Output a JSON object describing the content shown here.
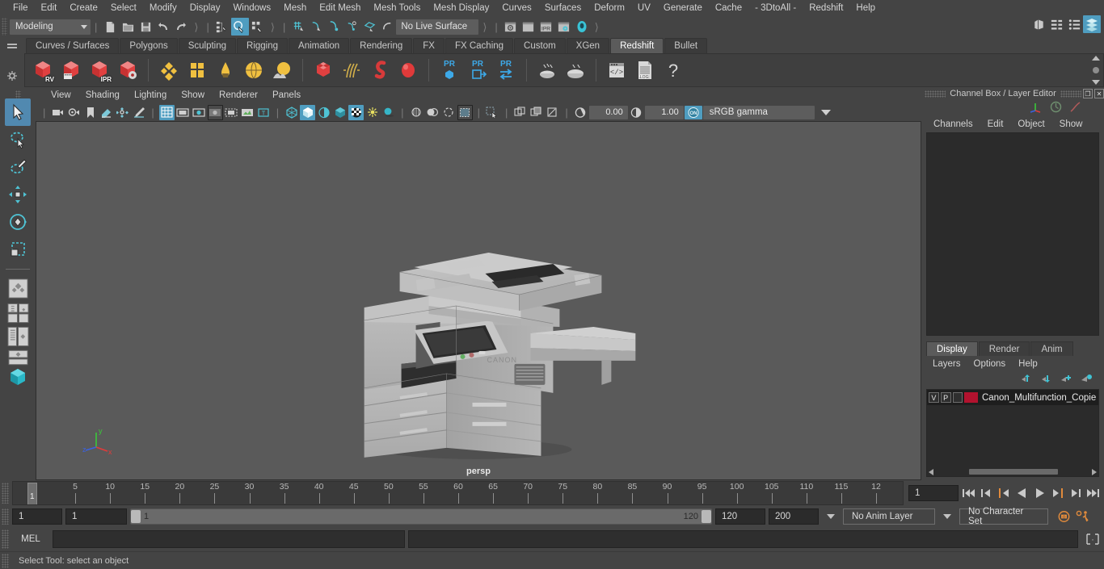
{
  "app": {
    "menus": [
      "File",
      "Edit",
      "Create",
      "Select",
      "Modify",
      "Display",
      "Windows",
      "Mesh",
      "Edit Mesh",
      "Mesh Tools",
      "Mesh Display",
      "Curves",
      "Surfaces",
      "Deform",
      "UV",
      "Generate",
      "Cache",
      "- 3DtoAll -",
      "Redshift",
      "Help"
    ]
  },
  "statusline": {
    "menuset": "Modeling",
    "live_surface": "No Live Surface",
    "icons": [
      "new-scene-icon",
      "open-scene-icon",
      "save-scene-icon",
      "undo-icon",
      "redo-icon",
      "select-by-hierarchy-icon",
      "select-by-object-icon",
      "select-by-component-icon",
      "snap-to-grid-icon",
      "snap-to-curve-icon",
      "snap-to-point-icon",
      "snap-to-projected-center-icon",
      "snap-to-view-plane-icon",
      "make-live-icon",
      "render-view-icon",
      "render-region-icon",
      "ipr-render-icon",
      "render-settings-icon",
      "hypershade-icon",
      "show-outliner-icon",
      "show-attribute-editor-icon",
      "show-tool-settings-icon",
      "show-channel-box-icon"
    ]
  },
  "shelf": {
    "tabs": [
      "Curves / Surfaces",
      "Polygons",
      "Sculpting",
      "Rigging",
      "Animation",
      "Rendering",
      "FX",
      "FX Caching",
      "Custom",
      "XGen",
      "Redshift",
      "Bullet"
    ],
    "active_tab": "Redshift",
    "icons": [
      {
        "name": "redshift-render-view-icon",
        "label": "RV"
      },
      {
        "name": "redshift-render-sequence-icon",
        "label": ""
      },
      {
        "name": "redshift-ipr-icon",
        "label": "IPR"
      },
      {
        "name": "redshift-render-settings-icon",
        "label": ""
      },
      {
        "name": "redshift-material-icon",
        "label": ""
      },
      {
        "name": "redshift-light-area-icon",
        "label": ""
      },
      {
        "name": "redshift-light-dome-icon",
        "label": ""
      },
      {
        "name": "redshift-light-ies-icon",
        "label": ""
      },
      {
        "name": "redshift-environment-icon",
        "label": ""
      },
      {
        "name": "redshift-proxy-icon",
        "label": ""
      },
      {
        "name": "redshift-hair-icon",
        "label": ""
      },
      {
        "name": "redshift-volume-icon",
        "label": ""
      },
      {
        "name": "redshift-sss-icon",
        "label": ""
      },
      {
        "name": "redshift-pr-object-icon",
        "label": "PR"
      },
      {
        "name": "redshift-pr-export-icon",
        "label": "PR"
      },
      {
        "name": "redshift-pr-transfer-icon",
        "label": "PR"
      },
      {
        "name": "redshift-bake-icon",
        "label": ""
      },
      {
        "name": "redshift-bake-set-icon",
        "label": ""
      },
      {
        "name": "redshift-script-icon",
        "label": ""
      },
      {
        "name": "redshift-log-icon",
        "label": ".LOG"
      },
      {
        "name": "redshift-help-icon",
        "label": "?"
      }
    ]
  },
  "toolbox": {
    "tools": [
      {
        "name": "select-tool",
        "active": true
      },
      {
        "name": "lasso-select-tool",
        "active": false
      },
      {
        "name": "paint-select-tool",
        "active": false
      },
      {
        "name": "move-tool",
        "active": false
      },
      {
        "name": "rotate-tool",
        "active": false
      },
      {
        "name": "scale-tool",
        "active": false
      },
      {
        "name": "last-tool-used",
        "active": false
      }
    ],
    "layouts": [
      "single-perspective-layout",
      "four-view-layout",
      "persp-outliner-layout",
      "persp-graph-layout",
      "hypershade-layout",
      "persp-bottom-layout"
    ]
  },
  "viewport": {
    "menus": [
      "View",
      "Shading",
      "Lighting",
      "Show",
      "Renderer",
      "Panels"
    ],
    "camera_label": "persp",
    "exposure": "0.00",
    "gamma": "1.00",
    "color_management": "sRGB gamma",
    "axis": {
      "x": "x",
      "y": "y",
      "z": "z"
    },
    "bg_color": "#5a5a5a",
    "model_color": "#b5b5b5",
    "toolbar_icons": [
      "select-camera-icon",
      "camera-attributes-icon",
      "bookmark-icon",
      "image-plane-icon",
      "two-d-pan-zoom-icon",
      "grease-pencil-icon",
      "grid-toggle-icon",
      "film-gate-icon",
      "resolution-gate-icon",
      "gate-mask-icon",
      "film-origin-icon",
      "exposure-icon",
      "hud-icon",
      "wireframe-icon",
      "smooth-shade-icon",
      "shaded-wireframe-icon",
      "textured-icon",
      "use-all-lights-icon",
      "shadows-icon",
      "ao-icon",
      "motion-blur-icon",
      "multisample-icon",
      "dof-icon",
      "isolate-select-icon",
      "xray-icon",
      "xray-joints-icon",
      "xray-active-components-icon",
      "exposure-value-icon",
      "gamma-value-icon",
      "color-management-icon"
    ]
  },
  "channelbox": {
    "title": "Channel Box / Layer Editor",
    "menus": [
      "Channels",
      "Edit",
      "Object",
      "Show"
    ],
    "header_icons": [
      "channel-box-icon",
      "anim-layer-icon",
      "graph-icon"
    ],
    "window_buttons": [
      "restore-icon",
      "close-icon"
    ]
  },
  "layereditor": {
    "tabs": [
      "Display",
      "Render",
      "Anim"
    ],
    "active_tab": "Display",
    "menus": [
      "Layers",
      "Options",
      "Help"
    ],
    "buttons": [
      "move-layer-up-icon",
      "move-layer-down-icon",
      "create-new-layer-icon",
      "create-layer-from-selected-icon"
    ],
    "layers": [
      {
        "visibility": "V",
        "playback": "P",
        "third": "",
        "color": "#b2122e",
        "name": "Canon_Multifunction_Copier"
      }
    ]
  },
  "timeslider": {
    "tick_labels": [
      "5",
      "10",
      "15",
      "20",
      "25",
      "30",
      "35",
      "40",
      "45",
      "50",
      "55",
      "60",
      "65",
      "70",
      "75",
      "80",
      "85",
      "90",
      "95",
      "100",
      "105",
      "110",
      "115",
      "12"
    ],
    "current_frame_marker": "1",
    "current_frame_field": "1",
    "playback_buttons": [
      "go-to-start-icon",
      "step-back-keyframe-icon",
      "step-back-frame-icon",
      "play-backwards-icon",
      "play-forwards-icon",
      "step-forward-frame-icon",
      "step-forward-keyframe-icon",
      "go-to-end-icon"
    ]
  },
  "rangeslider": {
    "anim_start": "1",
    "range_start": "1",
    "bar_start": "1",
    "bar_end": "120",
    "range_end": "120",
    "anim_end": "200",
    "anim_layer": "No Anim Layer",
    "character_set": "No Character Set",
    "right_icons": [
      "auto-keyframe-icon",
      "animation-preferences-icon"
    ]
  },
  "commandline": {
    "language_label": "MEL",
    "input_value": "",
    "output_value": "",
    "script-editor-icon": "script-editor-icon"
  },
  "helpline": {
    "text": "Select Tool: select an object"
  }
}
